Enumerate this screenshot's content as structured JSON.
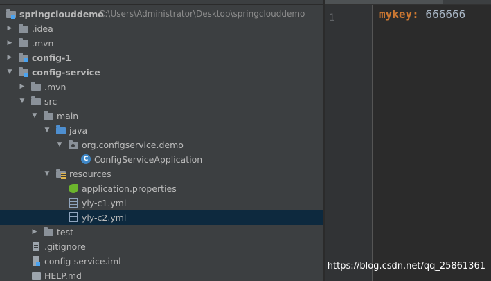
{
  "tree": {
    "root": {
      "name": "springclouddemo",
      "path": "C:\\Users\\Administrator\\Desktop\\springclouddemo"
    },
    "idea": ".idea",
    "mvn_root": ".mvn",
    "config1": "config-1",
    "config_service": "config-service",
    "mvn": ".mvn",
    "src": "src",
    "main": "main",
    "java": "java",
    "package": "org.configservice.demo",
    "main_class": "ConfigServiceApplication",
    "resources": "resources",
    "app_props": "application.properties",
    "yml1": "yly-c1.yml",
    "yml2": "yly-c2.yml",
    "test": "test",
    "gitignore": ".gitignore",
    "iml": "config-service.iml",
    "help": "HELP.md"
  },
  "editor": {
    "line_number": "1",
    "key": "mykey:",
    "value": " 666666"
  },
  "watermark": "https://blog.csdn.net/qq_25861361",
  "colors": {
    "selection": "#0d293e",
    "key": "#cc7832",
    "value": "#a9b7c6"
  }
}
